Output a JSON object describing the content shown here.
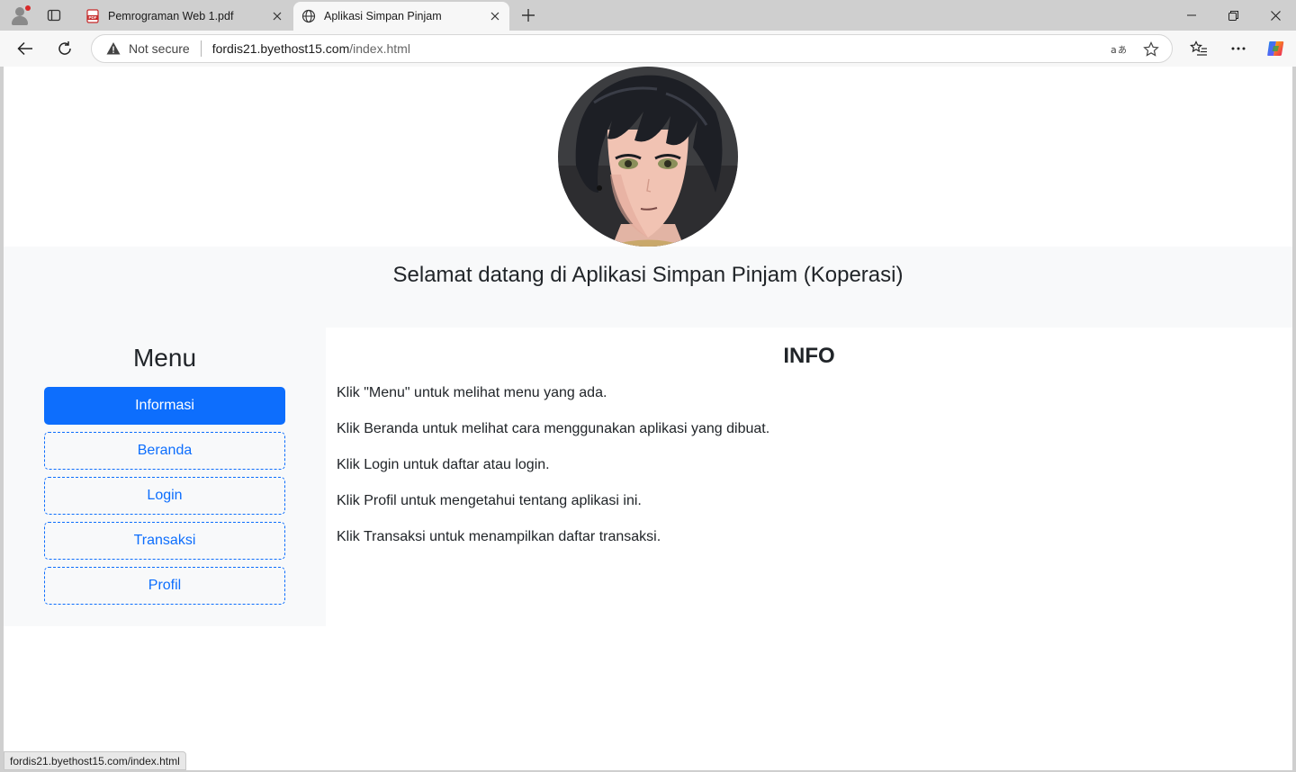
{
  "browser": {
    "tabs": [
      {
        "label": "Pemrograman Web 1.pdf",
        "icon": "pdf-icon"
      },
      {
        "label": "Aplikasi Simpan Pinjam",
        "icon": "globe-icon"
      }
    ],
    "address": {
      "security_label": "Not secure",
      "host": "fordis21.byethost15.com",
      "path": "/index.html"
    },
    "status_url": "fordis21.byethost15.com/index.html"
  },
  "page": {
    "avatar": "anime-boy-avatar",
    "welcome": "Selamat datang di Aplikasi Simpan Pinjam (Koperasi)",
    "menu": {
      "title": "Menu",
      "items": [
        {
          "label": "Informasi",
          "active": true
        },
        {
          "label": "Beranda",
          "active": false
        },
        {
          "label": "Login",
          "active": false
        },
        {
          "label": "Transaksi",
          "active": false
        },
        {
          "label": "Profil",
          "active": false
        }
      ]
    },
    "info": {
      "title": "INFO",
      "lines": [
        "Klik \"Menu\" untuk melihat menu yang ada.",
        "Klik Beranda untuk melihat cara menggunakan aplikasi yang dibuat.",
        "Klik Login untuk daftar atau login.",
        "Klik Profil untuk mengetahui tentang aplikasi ini.",
        "Klik Transaksi untuk menampilkan daftar transaksi."
      ]
    },
    "colors": {
      "primary": "#0d6efd",
      "band": "#f8f9fa",
      "text": "#212529"
    }
  }
}
